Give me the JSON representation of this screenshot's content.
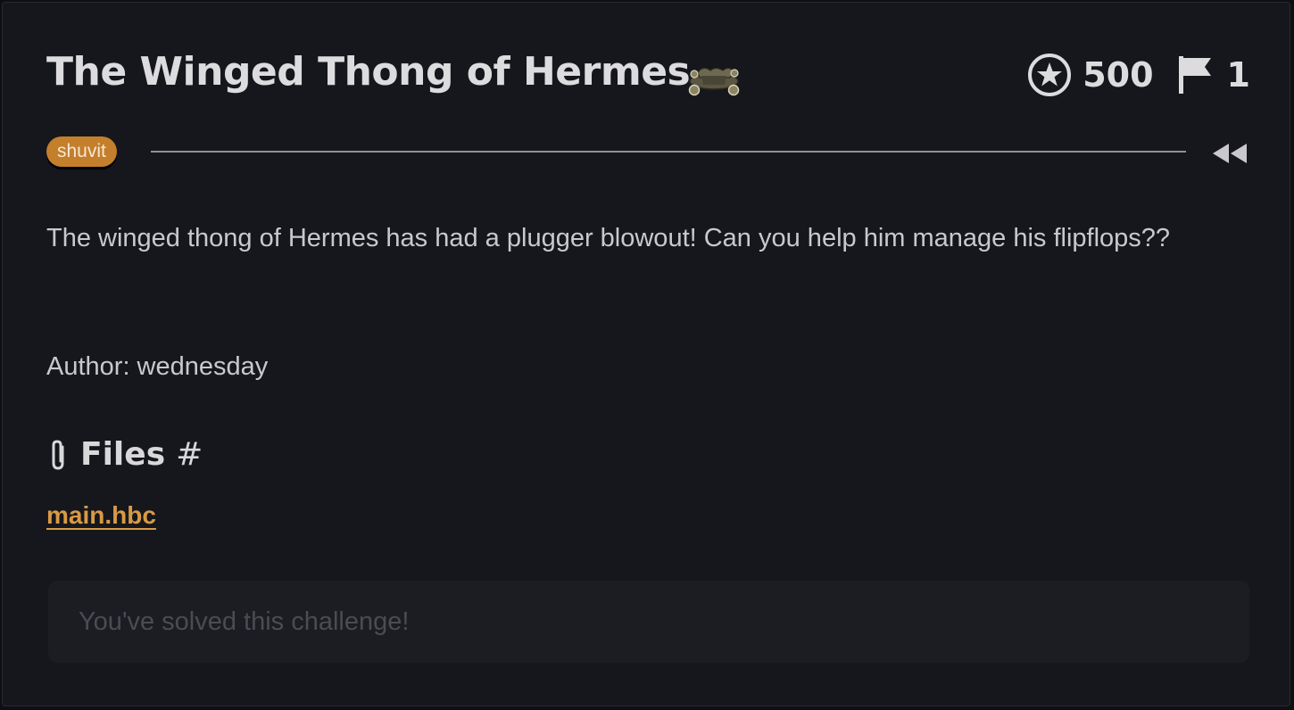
{
  "challenge": {
    "title": "The Winged Thong of Hermes",
    "points": "500",
    "solves": "1",
    "tag": "shuvit",
    "description": "The winged thong of Hermes has had a plugger blowout! Can you help him manage his flipflops??",
    "author": "Author: wednesday"
  },
  "files": {
    "heading": "Files",
    "anchor": "#",
    "items": [
      {
        "name": "main.hbc"
      }
    ]
  },
  "status": {
    "solved_message": "You've solved this challenge!"
  },
  "icons": {
    "points": "star-circle-icon",
    "solves": "flag-icon",
    "collapse": "rewind-icon",
    "files": "paperclip-icon",
    "mascot": "skateboard-mascot-icon"
  },
  "colors": {
    "background": "#15171d",
    "tag": "#c47f2c",
    "link": "#d99a45",
    "text": "#dcdcdf"
  }
}
